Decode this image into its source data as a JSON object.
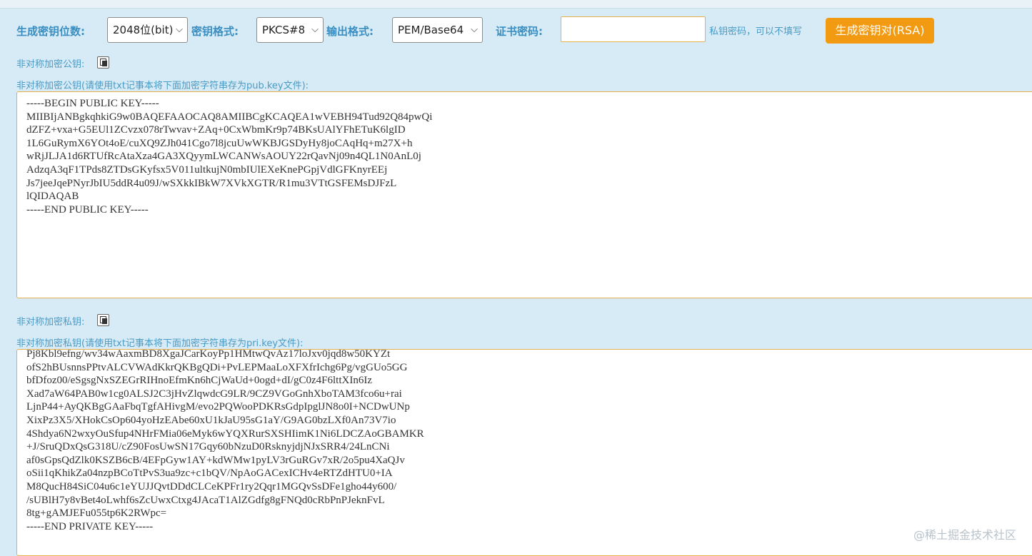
{
  "toolbar": {
    "key_bits_label": "生成密钥位数:",
    "key_bits_value": "2048位(bit)",
    "key_format_label": "密钥格式:",
    "key_format_value": "PKCS#8",
    "output_format_label": "输出格式:",
    "output_format_value": "PEM/Base64",
    "cert_password_label": "证书密码:",
    "cert_password_value": "",
    "cert_password_hint": "私钥密码，可以不填写",
    "generate_button": "生成密钥对(RSA)"
  },
  "public_key": {
    "section_label": "非对称加密公钥:",
    "textarea_label": "非对称加密公钥(请使用txt记事本将下面加密字符串存为pub.key文件):",
    "lines": [
      "-----BEGIN PUBLIC KEY-----",
      "MIIBIjANBgkqhkiG9w0BAQEFAAOCAQ8AMIIBCgKCAQEA1wVEBH94Tud92Q84pwQi",
      "dZFZ+vxa+G5EUl1ZCvzx078rTwvav+ZAq+0CxWbmKr9p74BKsUAlYFhETuK6lgID",
      "1L6GuRymX6YOt4oE/cuXQ9ZJh041Cgo7l8jcuUwWKBJGSDyHy8joCAqHq+m27X+h",
      "wRjJLJA1d6RTUfRcAtaXza4GA3XQyymLWCANWsAOUY22rQavNj09n4QL1N0AnL0j",
      "AdzqA3qF1TPds8ZTDsGKyfsx5V011ultkujN0mbIUlEXeKnePGpjVdlGFKnyrEEj",
      "Js7jeeJqePNyrJbIU5ddR4u09J/wSXkkIBkW7XVkXGTR/R1mu3VTtGSFEMsDJFzL",
      "lQIDAQAB",
      "-----END PUBLIC KEY-----"
    ]
  },
  "private_key": {
    "section_label": "非对称加密私钥:",
    "textarea_label": "非对称加密私钥(请使用txt记事本将下面加密字符串存为pri.key文件):",
    "lines": [
      "Pj8Kbl9efng/wv34wAaxmBD8XgaJCarKoyPp1HMtwQvAz17loJxv0jqd8w50KYZt",
      "ofS2hBUsnnsPPtvALCVWAdKkrQKBgQDi+PvLEPMaaLoXFXfrIchg6Pg/vgGUo5GG",
      "bfDfoz00/eSgsgNxSZEGrRIHnoEfmKn6hCjWaUd+0ogd+dI/gC0z4F6lttXIn6Iz",
      "Xad7aW64PAB0w1cg0ALSJ2C3jHvZlqwdcG9LR/9CZ9VGoGnhXboTAM3fco6u+rai",
      "LjnP44+AyQKBgGAaFbqTgfAHivgM/evo2PQWooPDKRsGdpIpglJN8o0I+NCDwUNp",
      "XixPz3X5/XHokCsOp604yoHzEAbe60xU1kJaU95sG1aY/G9AG0bzLXf0An73V7io",
      "4Shdya6N2wxyOuSfup4NHrFMia06eMyk6wYQXRurSXSHIimK1Ni6LDCZAoGBAMKR",
      "+J/SruQDxQsG318U/cZ90FosUwSN17Gqy60bNzuD0RsknyjdjNJxSRR4/24LnCNi",
      "af0sGpsQdZlk0KSZB6cB/4EFpGyw1AY+kdWMw1pyLV3rGuRGv7xR/2o5pu4XaQJv",
      "oSii1qKhikZa04nzpBCoTtPvS3ua9zc+c1bQV/NpAoGACexICHv4eRTZdHTU0+IA",
      "M8QucH84SiC04u6c1eYUJJQvtDDdCLCeKPFr1ry2Qqr1MGQvSsDFe1gho44y600/",
      "/sUBlH7y8vBet4oLwhf6sZcUwxCtxg4JAcaT1AlZGdfg8gFNQd0cRbPnPJeknFvL",
      "8tg+gAMJEFu055tp6K2RWpc=",
      "-----END PRIVATE KEY-----"
    ]
  },
  "watermark": "@稀土掘金技术社区",
  "icons": {
    "copy": "copy-icon",
    "dropdown": "chevron-down-icon"
  },
  "colors": {
    "page_background": "#d6ebf5",
    "label_blue": "#3a8ec1",
    "accent_orange": "#f29a12",
    "textarea_border": "#e8b04a"
  }
}
